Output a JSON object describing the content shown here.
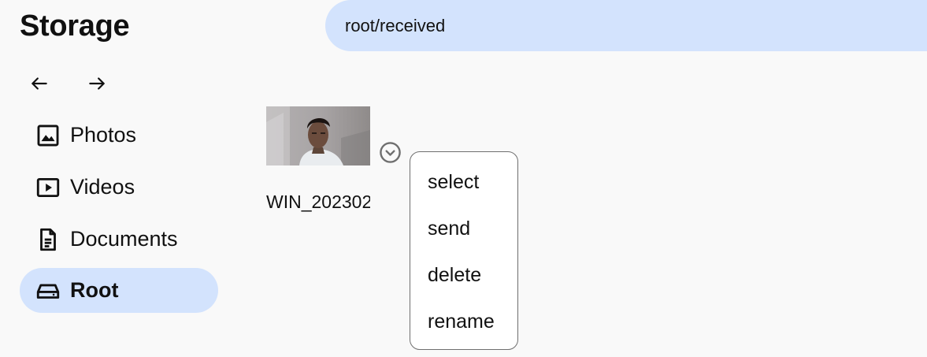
{
  "app": {
    "title": "Storage"
  },
  "path_bar": {
    "path": "root/received"
  },
  "navigation": {
    "back_icon": "arrow-left-icon",
    "forward_icon": "arrow-right-icon"
  },
  "sidebar": {
    "items": [
      {
        "label": "Photos",
        "icon": "image-icon",
        "active": false
      },
      {
        "label": "Videos",
        "icon": "video-icon",
        "active": false
      },
      {
        "label": "Documents",
        "icon": "document-icon",
        "active": false
      },
      {
        "label": "Root",
        "icon": "drive-icon",
        "active": true
      }
    ]
  },
  "files": [
    {
      "name": "WIN_202302",
      "type": "image",
      "options_icon": "chevron-down-circle-icon"
    }
  ],
  "context_menu": {
    "items": [
      "select",
      "send",
      "delete",
      "rename"
    ]
  },
  "colors": {
    "background": "#f9f9f9",
    "accent": "#d3e3fd",
    "text": "#111111",
    "menu_border": "#6f6f6f"
  }
}
